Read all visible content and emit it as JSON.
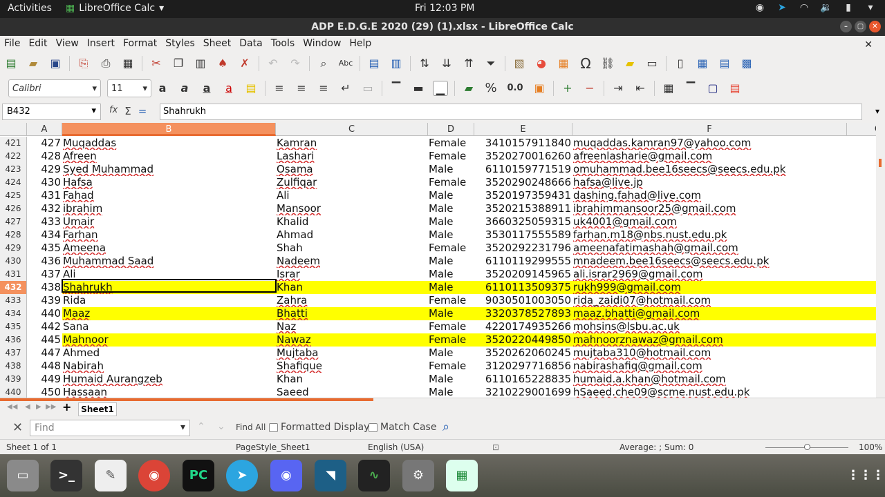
{
  "system": {
    "activities": "Activities",
    "app_name": "LibreOffice Calc",
    "clock": "Fri 12:03 PM"
  },
  "window": {
    "title": "ADP E.D.G.E 2020 (29) (1).xlsx - LibreOffice Calc"
  },
  "menu": [
    "File",
    "Edit",
    "View",
    "Insert",
    "Format",
    "Styles",
    "Sheet",
    "Data",
    "Tools",
    "Window",
    "Help"
  ],
  "toolbar": {
    "font_name": "Calibri",
    "font_size": "11",
    "percent": "%",
    "decimal": "0.0"
  },
  "formula": {
    "cell_ref": "B432",
    "content": "Shahrukh"
  },
  "columns": [
    "A",
    "B",
    "C",
    "D",
    "E",
    "F",
    "G"
  ],
  "rows": [
    {
      "num": "421",
      "a": "427",
      "b": "Muqaddas",
      "c": "Kamran",
      "d": "Female",
      "e": "3410157911840",
      "f": "muqaddas.kamran97@yahoo.com",
      "hl": false
    },
    {
      "num": "422",
      "a": "428",
      "b": "Afreen",
      "c": "Lashari",
      "d": "Female",
      "e": "3520270016260",
      "f": "afreenlasharie@gmail.com",
      "hl": false
    },
    {
      "num": "423",
      "a": "429",
      "b": "Syed Muhammad",
      "c": "Osama",
      "d": "Male",
      "e": "6110159771519",
      "f": "omuhammad.bee16seecs@seecs.edu.pk",
      "hl": false
    },
    {
      "num": "424",
      "a": "430",
      "b": "Hafsa",
      "c": "Zulfiqar",
      "d": "Female",
      "e": "3520290248666",
      "f": "hafsa@live.jp",
      "hl": false
    },
    {
      "num": "425",
      "a": "431",
      "b": "Fahad",
      "c": "Ali",
      "d": "Male",
      "e": "3520197359431",
      "f": "dashing.fahad@live.com",
      "hl": false
    },
    {
      "num": "426",
      "a": "432",
      "b": "ibrahim",
      "c": "Mansoor",
      "d": "Male",
      "e": "3520215388911",
      "f": "ibrahimmansoor25@gmail.com",
      "hl": false
    },
    {
      "num": "427",
      "a": "433",
      "b": "Umair",
      "c": "Khalid",
      "d": "Male",
      "e": "3660325059315",
      "f": "uk4001@gmail.com",
      "hl": false
    },
    {
      "num": "428",
      "a": "434",
      "b": "Farhan",
      "c": "Ahmad",
      "d": "Male",
      "e": "3530117555589",
      "f": "farhan.m18@nbs.nust.edu.pk",
      "hl": false
    },
    {
      "num": "429",
      "a": "435",
      "b": "Ameena",
      "c": "Shah",
      "d": "Female",
      "e": "3520292231796",
      "f": "ameenafatimashah@gmail.com",
      "hl": false
    },
    {
      "num": "430",
      "a": "436",
      "b": "Muhammad Saad",
      "c": "Nadeem",
      "d": "Male",
      "e": "6110119299555",
      "f": "mnadeem.bee16seecs@seecs.edu.pk",
      "hl": false
    },
    {
      "num": "431",
      "a": "437",
      "b": "Ali",
      "c": "Israr",
      "d": "Male",
      "e": "3520209145965",
      "f": "ali.israr2969@gmail.com",
      "hl": false
    },
    {
      "num": "432",
      "a": "438",
      "b": "Shahrukh",
      "c": "Khan",
      "d": "Male",
      "e": "6110113509375",
      "f": "rukh999@gmail.com",
      "hl": true
    },
    {
      "num": "433",
      "a": "439",
      "b": "Rida",
      "c": "Zahra",
      "d": "Female",
      "e": "9030501003050",
      "f": "rida_zaidi07@hotmail.com",
      "hl": false
    },
    {
      "num": "434",
      "a": "440",
      "b": "Maaz",
      "c": "Bhatti",
      "d": "Male",
      "e": "3320378527893",
      "f": "maaz.bhatti@gmail.com",
      "hl": true
    },
    {
      "num": "435",
      "a": "442",
      "b": "Sana",
      "c": "Naz",
      "d": "Female",
      "e": "4220174935266",
      "f": "mohsins@lsbu.ac.uk",
      "hl": false
    },
    {
      "num": "436",
      "a": "445",
      "b": "Mahnoor",
      "c": "Nawaz",
      "d": "Female",
      "e": "3520220449850",
      "f": "mahnoorznawaz@gmail.com",
      "hl": true
    },
    {
      "num": "437",
      "a": "447",
      "b": "Ahmed",
      "c": "Mujtaba",
      "d": "Male",
      "e": "3520262060245",
      "f": "mujtaba310@hotmail.com",
      "hl": false
    },
    {
      "num": "438",
      "a": "448",
      "b": "Nabirah",
      "c": "Shafique",
      "d": "Female",
      "e": "3120297716856",
      "f": "nabirashafiq@gmail.com",
      "hl": false
    },
    {
      "num": "439",
      "a": "449",
      "b": "Humaid Aurangzeb",
      "c": "Khan",
      "d": "Male",
      "e": "6110165228835",
      "f": "humaid.a.khan@hotmail.com",
      "hl": false
    },
    {
      "num": "440",
      "a": "450",
      "b": "Hassaan",
      "c": "Saeed",
      "d": "Male",
      "e": "3210229001699",
      "f": "hSaeed.che09@scme.nust.edu.pk",
      "hl": false
    }
  ],
  "sheet_tab": "Sheet1",
  "find": {
    "placeholder": "Find",
    "find_all": "Find All",
    "formatted_display": "Formatted Display",
    "match_case": "Match Case"
  },
  "status": {
    "sheet": "Sheet 1 of 1",
    "page_style": "PageStyle_Sheet1",
    "language": "English (USA)",
    "summary": "Average: ; Sum: 0",
    "zoom": "100%"
  },
  "dock": [
    "files",
    "terminal",
    "text-editor",
    "chrome",
    "pycharm",
    "telegram",
    "discord",
    "mysql-workbench",
    "system-monitor",
    "settings",
    "libreoffice-calc",
    "app-grid"
  ]
}
